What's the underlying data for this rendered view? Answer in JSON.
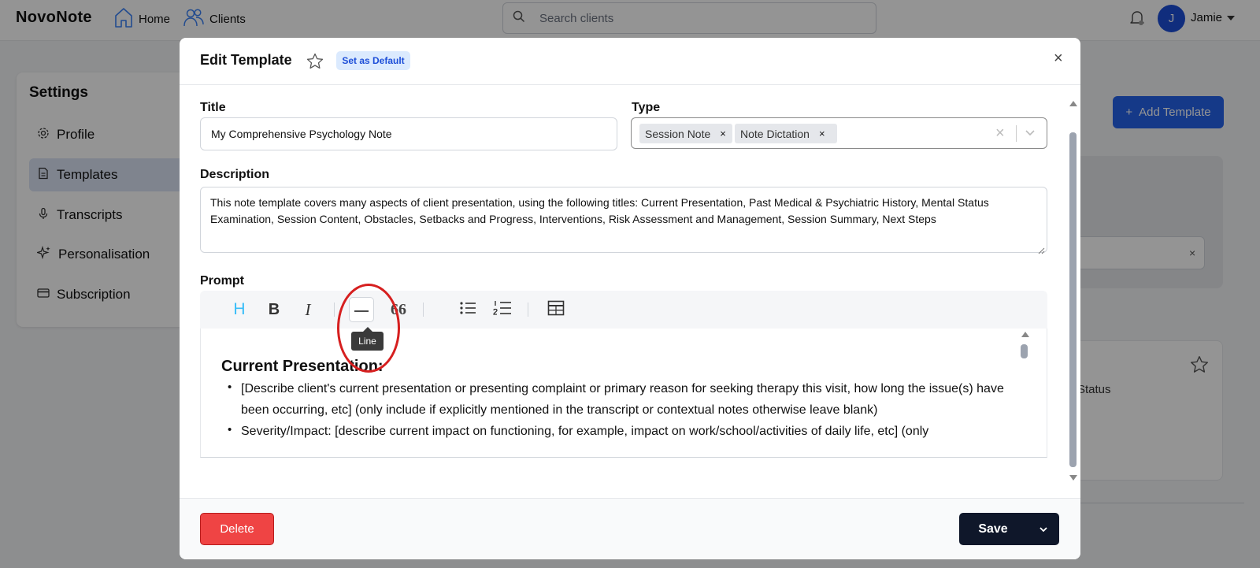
{
  "app": {
    "logo": "NovoNote",
    "nav": [
      {
        "label": "Home",
        "icon": "home-icon"
      },
      {
        "label": "Clients",
        "icon": "users-icon"
      }
    ],
    "search": {
      "placeholder": "Search clients",
      "value": ""
    },
    "user": {
      "initial": "J",
      "name": "Jamie"
    }
  },
  "settings": {
    "title": "Settings",
    "items": [
      {
        "label": "Profile",
        "icon": "gear-icon"
      },
      {
        "label": "Templates",
        "icon": "document-icon",
        "active": true
      },
      {
        "label": "Transcripts",
        "icon": "microphone-icon"
      },
      {
        "label": "Personalisation",
        "icon": "sparkle-icon"
      },
      {
        "label": "Subscription",
        "icon": "credit-card-icon"
      }
    ]
  },
  "background": {
    "add_template_label": "Add Template",
    "add_template_icon": "+",
    "card_text_fragment": "Status"
  },
  "modal": {
    "title": "Edit Template",
    "default_badge": "Set as Default",
    "close_glyph": "×",
    "title_label": "Title",
    "title_value": "My Comprehensive Psychology Note",
    "type_label": "Type",
    "type_chips": [
      "Session Note",
      "Note Dictation"
    ],
    "chip_remove_glyph": "×",
    "clear_glyph": "×",
    "description_label": "Description",
    "description_value": "This note template covers many aspects of client presentation, using the following titles: Current Presentation, Past Medical & Psychiatric History, Mental Status Examination, Session Content, Obstacles, Setbacks and Progress, Interventions, Risk Assessment and Management, Session Summary, Next Steps",
    "prompt_label": "Prompt",
    "toolbar": {
      "heading_glyph": "H",
      "bold_glyph": "B",
      "italic_glyph": "I",
      "quote_glyph": "66"
    },
    "tooltip": "Line",
    "editor": {
      "heading": "Current Presentation:",
      "bullet_glyph": "•",
      "bullets": [
        "[Describe client's current presentation or presenting complaint or primary reason for seeking therapy this visit, how long the issue(s) have been occurring, etc] (only include if explicitly mentioned in the transcript or contextual notes otherwise leave blank)",
        "Severity/Impact: [describe current impact on functioning, for example, impact on work/school/activities of daily life, etc] (only"
      ]
    },
    "footer": {
      "delete_label": "Delete",
      "save_label": "Save"
    }
  },
  "colors": {
    "primary": "#2563eb",
    "danger": "#ef4444",
    "dark": "#0f172a",
    "highlight": "#d61f1f",
    "heading_icon": "#38bdf8"
  }
}
